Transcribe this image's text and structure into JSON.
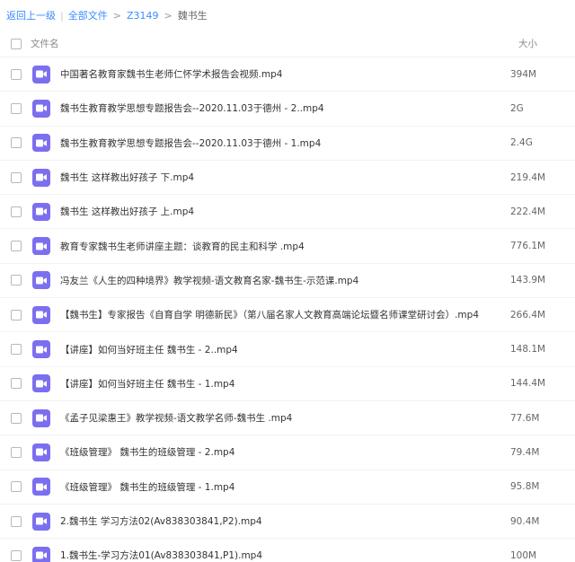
{
  "breadcrumb": {
    "back": "返回上一级",
    "all_files": "全部文件",
    "folder": "Z3149",
    "current": "魏书生"
  },
  "header": {
    "name_col": "文件名",
    "size_col": "大小"
  },
  "files": [
    {
      "name": "中国著名教育家魏书生老师仁怀学术报告会视频.mp4",
      "size": "394M"
    },
    {
      "name": "魏书生教育教学思想专题报告会--2020.11.03于德州 - 2..mp4",
      "size": "2G"
    },
    {
      "name": "魏书生教育教学思想专题报告会--2020.11.03于德州 - 1.mp4",
      "size": "2.4G"
    },
    {
      "name": "魏书生 这样教出好孩子 下.mp4",
      "size": "219.4M"
    },
    {
      "name": "魏书生 这样教出好孩子 上.mp4",
      "size": "222.4M"
    },
    {
      "name": "教育专家魏书生老师讲座主题：谈教育的民主和科学 .mp4",
      "size": "776.1M"
    },
    {
      "name": "冯友兰《人生的四种境界》教学视频-语文教育名家-魏书生-示范课.mp4",
      "size": "143.9M"
    },
    {
      "name": "【魏书生】专家报告《自育自学 明德新民》（第八届名家人文教育高端论坛暨名师课堂研讨会）.mp4",
      "size": "266.4M"
    },
    {
      "name": "【讲座】如何当好班主任 魏书生 - 2..mp4",
      "size": "148.1M"
    },
    {
      "name": "【讲座】如何当好班主任 魏书生 - 1.mp4",
      "size": "144.4M"
    },
    {
      "name": "《孟子见梁惠王》教学视频-语文教学名师-魏书生 .mp4",
      "size": "77.6M"
    },
    {
      "name": "《班级管理》 魏书生的班级管理 - 2.mp4",
      "size": "79.4M"
    },
    {
      "name": "《班级管理》 魏书生的班级管理 - 1.mp4",
      "size": "95.8M"
    },
    {
      "name": "2.魏书生 学习方法02(Av838303841,P2).mp4",
      "size": "90.4M"
    },
    {
      "name": "1.魏书生-学习方法01(Av838303841,P1).mp4",
      "size": "100M"
    }
  ],
  "icon_color": "#7b6ff0",
  "link_color": "#3b8cff"
}
